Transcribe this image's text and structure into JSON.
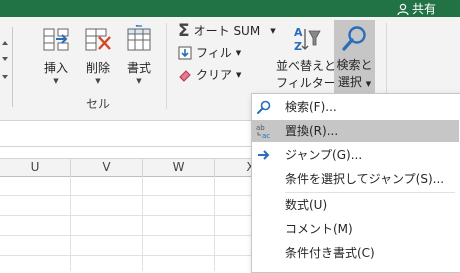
{
  "titlebar": {
    "share_label": "共有",
    "color": "#217346"
  },
  "ribbon": {
    "cells_group": {
      "label": "セル",
      "buttons": [
        {
          "label": "挿入",
          "icon": "insert-cells-icon"
        },
        {
          "label": "削除",
          "icon": "delete-cells-icon"
        },
        {
          "label": "書式",
          "icon": "format-cells-icon"
        }
      ]
    },
    "editing_group": {
      "autosum_label": "オート SUM",
      "fill_label": "フィル",
      "clear_label": "クリア",
      "sort_filter_label_1": "並べ替えと",
      "sort_filter_label_2": "フィルター",
      "find_select_label_1": "検索と",
      "find_select_label_2": "選択"
    }
  },
  "columns": [
    "U",
    "V",
    "W",
    "X"
  ],
  "find_menu": {
    "items": [
      {
        "label": "検索(F)...",
        "icon": "magnifier-icon"
      },
      {
        "label": "置換(R)...",
        "icon": "replace-icon",
        "hover": true
      },
      {
        "label": "ジャンプ(G)...",
        "icon": "arrow-right-icon"
      },
      {
        "label": "条件を選択してジャンプ(S)..."
      },
      {
        "label": "数式(U)"
      },
      {
        "label": "コメント(M)"
      },
      {
        "label": "条件付き書式(C)"
      }
    ]
  }
}
